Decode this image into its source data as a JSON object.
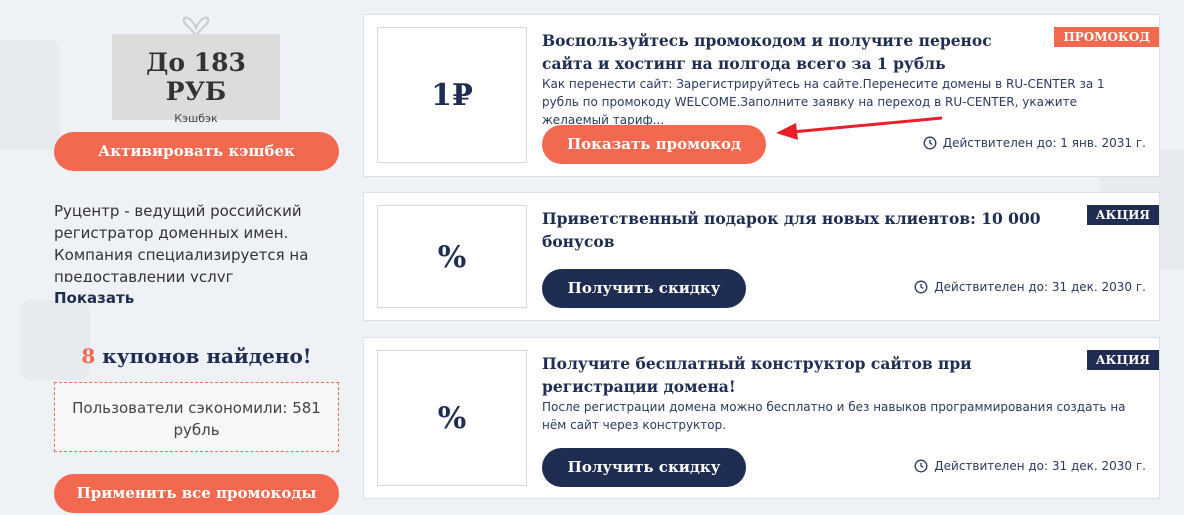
{
  "sidebar": {
    "cashback_amount": "До 183 РУБ",
    "cashback_label": "Кэшбэк",
    "activate_button": "Активировать кэшбек",
    "description": "Руцентр - ведущий российский регистратор доменных имен. Компания специализируется на предоставлении услуг хостинга,",
    "show_more": "Показать",
    "coupons_count": "8",
    "coupons_found_text": " купонов найдено!",
    "savings_line1": "Пользователи сэкономили: 581",
    "savings_line2": "рубль",
    "apply_all_button": "Применить все промокоды"
  },
  "coupons": [
    {
      "thumb": "1₽",
      "tag": "ПРОМОКОД",
      "title": "Воспользуйтесь промокодом и получите перенос сайта и хостинг на полгода всего за 1 рубль",
      "description": "Как перенести сайт: Зарегистрируйтесь на сайте.Перенесите домены в RU-CENTER за 1 рубль по промокоду WELCOME.Заполните заявку на переход в RU-CENTER, укажите желаемый тариф...",
      "button": "Показать промокод",
      "valid_until": "Действителен до: 1 янв. 2031 г."
    },
    {
      "thumb": "%",
      "tag": "АКЦИЯ",
      "title": "Приветственный подарок для новых клиентов: 10 000 бонусов",
      "description": "",
      "button": "Получить скидку",
      "valid_until": "Действителен до: 31 дек. 2030 г."
    },
    {
      "thumb": "%",
      "tag": "АКЦИЯ",
      "title": "Получите бесплатный конструктор сайтов при регистрации домена!",
      "description": "После регистрации домена можно бесплатно и без навыков программирования создать на нём сайт через конструктор.",
      "button": "Получить скидку",
      "valid_until": "Действителен до: 31 дек. 2030 г."
    }
  ],
  "colors": {
    "accent": "#f2694f",
    "navy": "#1f2d52",
    "arrow": "#e8202a"
  }
}
